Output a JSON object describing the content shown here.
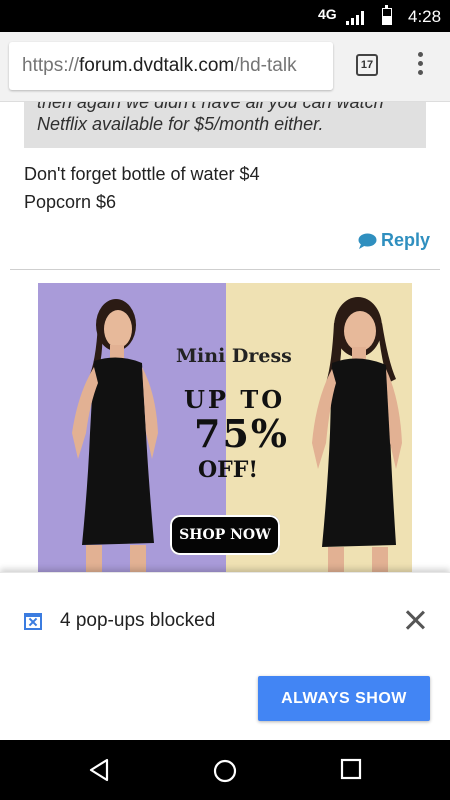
{
  "status_bar": {
    "network": "4G",
    "time": "4:28",
    "battery_level": 0.55
  },
  "browser": {
    "url_scheme": "https://",
    "url_host": "forum.dvdtalk.com",
    "url_path": "/hd-talk",
    "tab_count": "17",
    "menu_icon": "overflow-menu-icon"
  },
  "post": {
    "quote_line1": "then again we didn't have all you can watch",
    "quote_line2": "Netflix available for $5/month either.",
    "line1": "Don't forget bottle of water $4",
    "line2": "Popcorn $6",
    "reply_label": "Reply"
  },
  "ad": {
    "title": "Mini Dress",
    "up_to": "UP TO",
    "percent": "75%",
    "off": "OFF!",
    "cta": "SHOP NOW",
    "colors": {
      "left_bg": "#a99bd9",
      "right_bg": "#efe1b3"
    }
  },
  "popup_infobar": {
    "message": "4 pop-ups blocked",
    "button": "ALWAYS SHOW",
    "accent": "#4285f4"
  },
  "nav_bar": {
    "back_icon": "back-icon",
    "home_icon": "home-icon",
    "recents_icon": "recents-icon"
  }
}
